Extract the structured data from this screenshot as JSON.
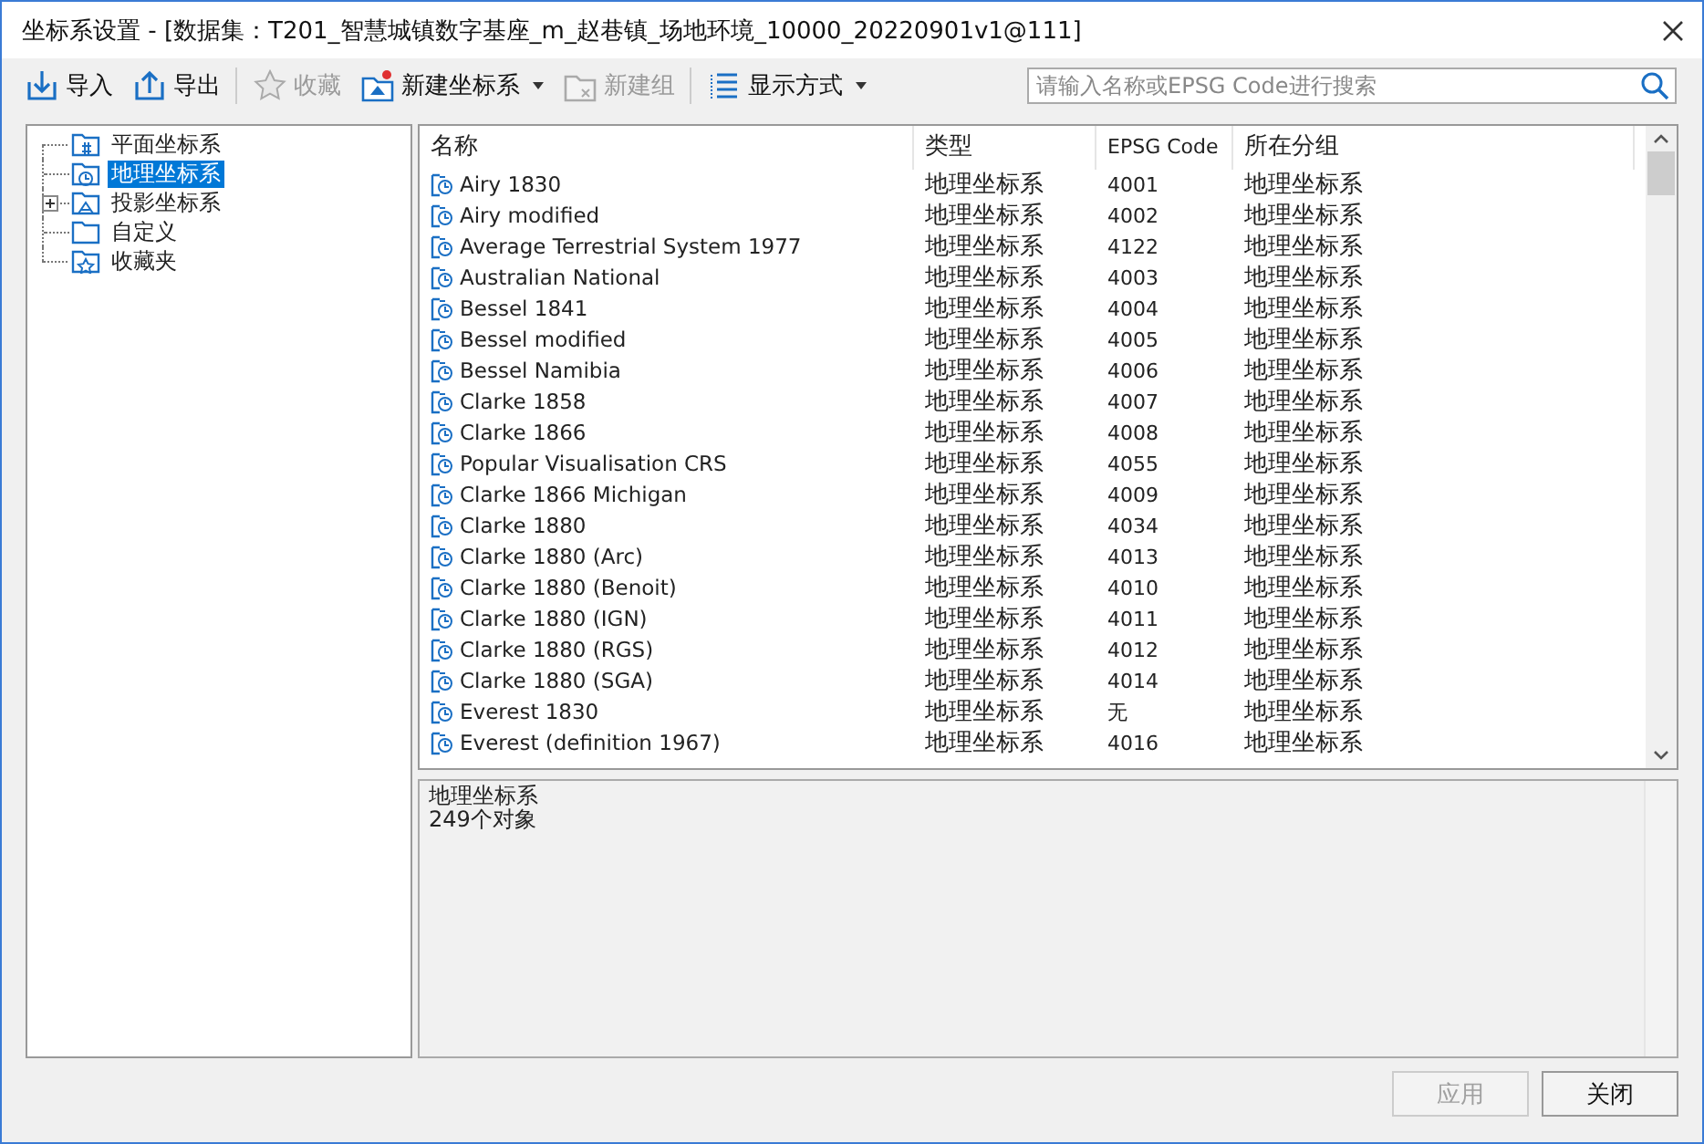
{
  "window": {
    "title": "坐标系设置 - [数据集：T201_智慧城镇数字基座_m_赵巷镇_场地环境_10000_20220901v1@111]"
  },
  "toolbar": [
    {
      "kind": "import",
      "label": "导入",
      "disabled": false,
      "dropdown": false
    },
    {
      "kind": "export",
      "label": "导出",
      "disabled": false,
      "dropdown": false
    },
    {
      "kind": "favorite",
      "label": "收藏",
      "disabled": true,
      "dropdown": false
    },
    {
      "kind": "new-crs",
      "label": "新建坐标系",
      "disabled": false,
      "dropdown": true
    },
    {
      "kind": "new-group",
      "label": "新建组",
      "disabled": true,
      "dropdown": false
    },
    {
      "kind": "display",
      "label": "显示方式",
      "disabled": false,
      "dropdown": true
    }
  ],
  "search": {
    "placeholder": "请输入名称或EPSG Code进行搜索"
  },
  "tree": [
    {
      "kind": "plane",
      "label": "平面坐标系",
      "selected": false,
      "expandable": false
    },
    {
      "kind": "geo",
      "label": "地理坐标系",
      "selected": true,
      "expandable": false
    },
    {
      "kind": "proj",
      "label": "投影坐标系",
      "selected": false,
      "expandable": true,
      "expanded": false
    },
    {
      "kind": "custom",
      "label": "自定义",
      "selected": false,
      "expandable": false
    },
    {
      "kind": "fav",
      "label": "收藏夹",
      "selected": false,
      "expandable": false
    }
  ],
  "table": {
    "columns": [
      "名称",
      "类型",
      "EPSG Code",
      "所在分组"
    ],
    "rows": [
      [
        "Airy 1830",
        "地理坐标系",
        "4001",
        "地理坐标系"
      ],
      [
        "Airy modified",
        "地理坐标系",
        "4002",
        "地理坐标系"
      ],
      [
        "Average Terrestrial System 1977",
        "地理坐标系",
        "4122",
        "地理坐标系"
      ],
      [
        "Australian National",
        "地理坐标系",
        "4003",
        "地理坐标系"
      ],
      [
        "Bessel 1841",
        "地理坐标系",
        "4004",
        "地理坐标系"
      ],
      [
        "Bessel modified",
        "地理坐标系",
        "4005",
        "地理坐标系"
      ],
      [
        "Bessel Namibia",
        "地理坐标系",
        "4006",
        "地理坐标系"
      ],
      [
        "Clarke 1858",
        "地理坐标系",
        "4007",
        "地理坐标系"
      ],
      [
        "Clarke 1866",
        "地理坐标系",
        "4008",
        "地理坐标系"
      ],
      [
        "Popular Visualisation CRS",
        "地理坐标系",
        "4055",
        "地理坐标系"
      ],
      [
        "Clarke 1866 Michigan",
        "地理坐标系",
        "4009",
        "地理坐标系"
      ],
      [
        "Clarke 1880",
        "地理坐标系",
        "4034",
        "地理坐标系"
      ],
      [
        "Clarke 1880 (Arc)",
        "地理坐标系",
        "4013",
        "地理坐标系"
      ],
      [
        "Clarke 1880 (Benoit)",
        "地理坐标系",
        "4010",
        "地理坐标系"
      ],
      [
        "Clarke 1880 (IGN)",
        "地理坐标系",
        "4011",
        "地理坐标系"
      ],
      [
        "Clarke 1880 (RGS)",
        "地理坐标系",
        "4012",
        "地理坐标系"
      ],
      [
        "Clarke 1880 (SGA)",
        "地理坐标系",
        "4014",
        "地理坐标系"
      ],
      [
        "Everest 1830",
        "地理坐标系",
        "无",
        "地理坐标系"
      ],
      [
        "Everest (definition 1967)",
        "地理坐标系",
        "4016",
        "地理坐标系"
      ]
    ]
  },
  "description": [
    "地理坐标系",
    "249个对象"
  ],
  "buttons": [
    {
      "label": "应用",
      "disabled": true
    },
    {
      "label": "关闭",
      "disabled": false
    }
  ]
}
